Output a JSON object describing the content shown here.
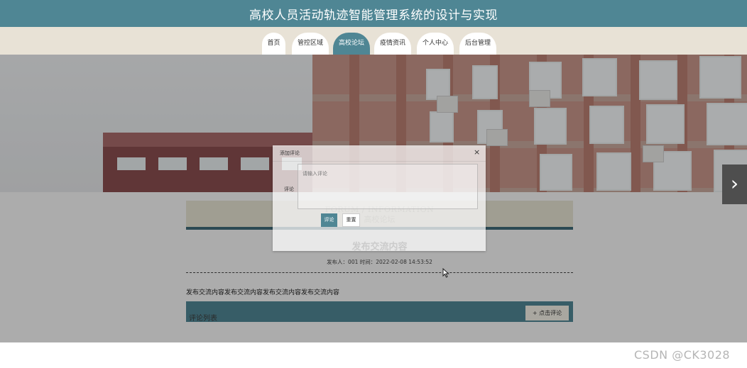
{
  "header": {
    "title": "高校人员活动轨迹智能管理系统的设计与实现"
  },
  "nav": {
    "items": [
      "首页",
      "管控区域",
      "高校论坛",
      "疫情资讯",
      "个人中心",
      "后台管理"
    ],
    "active": "高校论坛"
  },
  "section": {
    "title_en": "FORUM / INFORMATION",
    "title_cn": "高校论坛"
  },
  "post": {
    "title": "发布交流内容",
    "meta": "发布人：001 时间：2022-02-08 14:53:52",
    "body": "发布交流内容发布交流内容发布交流内容发布交流内容"
  },
  "comments": {
    "label": "评论列表",
    "add_button": "+ 点击评论"
  },
  "modal": {
    "title": "添加评论",
    "close": "×",
    "field_label": "评论",
    "placeholder": "请输入评论",
    "submit": "评论",
    "reset": "重置"
  },
  "carousel": {
    "next": "›",
    "slides": 2,
    "current": 2
  },
  "watermark": "CSDN @CK3028",
  "colors": {
    "primary": "#4f8694",
    "nav_bg": "#e8e2d6",
    "section_bg": "#e6e3d2"
  }
}
